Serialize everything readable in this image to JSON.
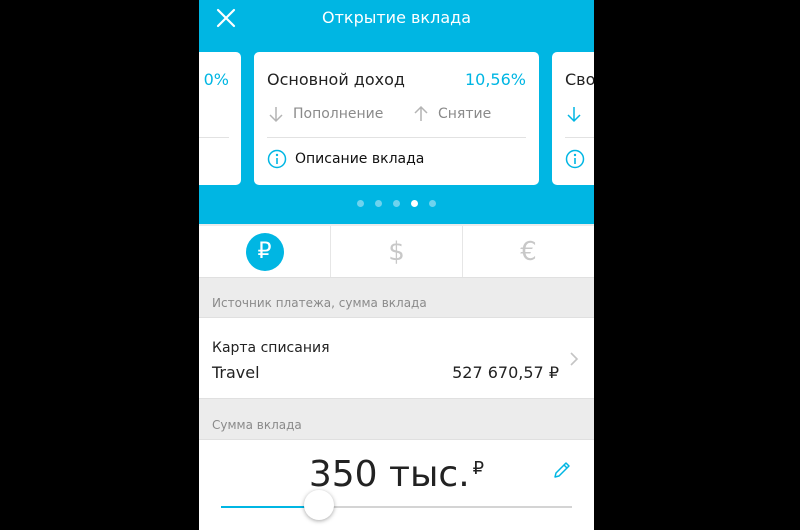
{
  "header": {
    "title": "Открытие вклада",
    "close_icon": "close-icon"
  },
  "cards": {
    "prev": {
      "rate": "0%"
    },
    "main": {
      "name": "Основной доход",
      "rate": "10,56%",
      "deposit_label": "Пополнение",
      "withdraw_label": "Снятие",
      "description_label": "Описание вклада"
    },
    "next": {
      "name": "Сво"
    }
  },
  "carousel": {
    "count": 5,
    "active_index": 3
  },
  "currency_tabs": [
    {
      "symbol": "₽",
      "selected": true
    },
    {
      "symbol": "$",
      "selected": false
    },
    {
      "symbol": "€",
      "selected": false
    }
  ],
  "source_section": {
    "header": "Источник платежа, сумма вклада",
    "card_label": "Карта списания",
    "card_name": "Travel",
    "balance": "527 670,57 ₽"
  },
  "amount_section": {
    "header": "Сумма вклада",
    "value": "350 тыс.",
    "currency": "₽",
    "slider_fraction": 0.28
  },
  "colors": {
    "accent": "#00b6e3",
    "background": "#ececec"
  }
}
